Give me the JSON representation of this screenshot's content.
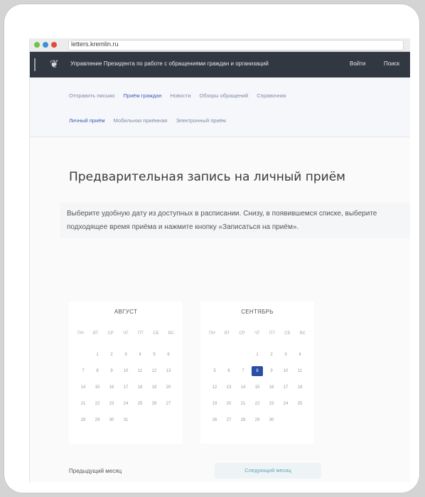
{
  "browser": {
    "url": "letters.kremlin.ru",
    "dot_colors": [
      "#6fc24c",
      "#3e8fd8",
      "#e14b3b"
    ]
  },
  "header": {
    "title": "Управление Президента по работе с обращениями граждан и организаций",
    "links": [
      "Войти",
      "Поиск"
    ]
  },
  "nav": {
    "row1": [
      "Отправить письмо",
      "Приём граждан",
      "Новости",
      "Обзоры обращений",
      "Справочник"
    ],
    "row1_active": "Приём граждан",
    "row2": [
      "Личный приём",
      "Мобильная приёмная",
      "Электронный приём"
    ],
    "row2_active": "Личный приём"
  },
  "page": {
    "title": "Предварительная запись на личный приём",
    "intro": "Выберите удобную дату из доступных в расписании. Снизу, в появившемся списке, выберите подходящее время приёма и нажмите кнопку «Записаться на приём»."
  },
  "calendars": [
    {
      "month": "АВГУСТ",
      "weekdays": [
        "ПН",
        "ВТ",
        "СР",
        "ЧТ",
        "ПТ",
        "СБ",
        "ВС"
      ],
      "first_weekday": 1,
      "days": 31,
      "selected": null
    },
    {
      "month": "СЕНТЯБРЬ",
      "weekdays": [
        "ПН",
        "ВТ",
        "СР",
        "ЧТ",
        "ПТ",
        "СБ",
        "ВС"
      ],
      "first_weekday": 3,
      "days": 30,
      "selected": 8
    }
  ],
  "buttons": {
    "prev": "Предыдущий месяц",
    "next": "Следующий месяц"
  },
  "colors": {
    "header_bg": "#313841",
    "accent": "#2a4ea5",
    "link": "#7c8aa8"
  }
}
